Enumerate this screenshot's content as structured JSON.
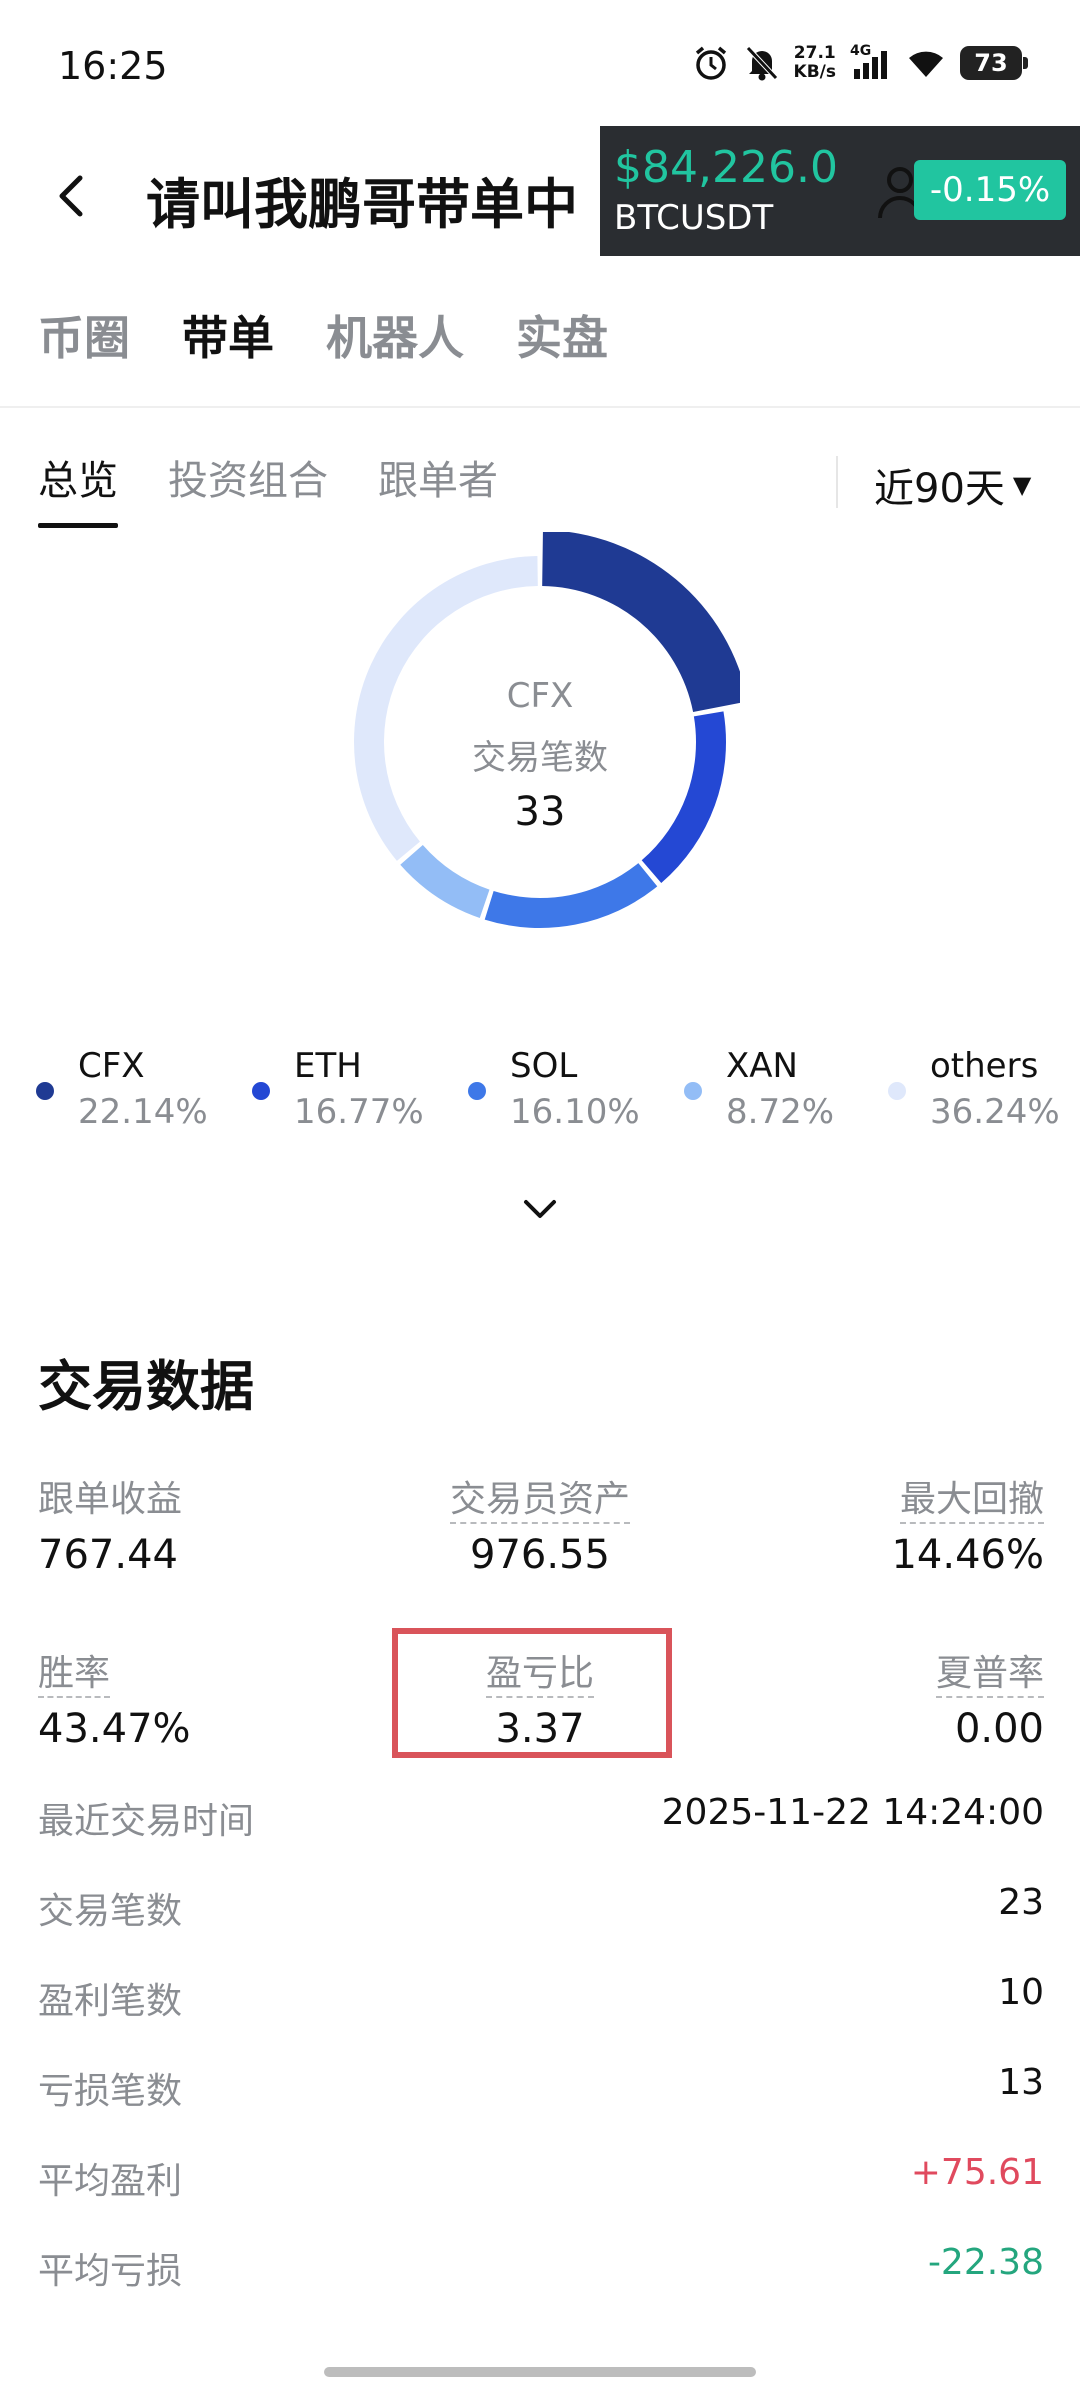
{
  "status_bar": {
    "time": "16:25",
    "net_speed_value": "27.1",
    "net_speed_unit": "KB/s",
    "network": "4G",
    "battery": "73"
  },
  "header": {
    "title": "请叫我鹏哥带单中",
    "back_icon": "chevron-left-icon"
  },
  "ticker": {
    "price": "$84,226.0",
    "symbol": "BTCUSDT",
    "change": "-0.15%"
  },
  "main_tabs": [
    "币圈",
    "带单",
    "机器人",
    "实盘"
  ],
  "main_tab_active": 1,
  "sub_tabs": [
    "总览",
    "投资组合",
    "跟单者"
  ],
  "sub_tab_active": 0,
  "period": "近90天",
  "chart_data": {
    "type": "pie",
    "categories": [
      "CFX",
      "ETH",
      "SOL",
      "XAN",
      "others"
    ],
    "values": [
      22.14,
      16.77,
      16.1,
      8.72,
      36.24
    ],
    "labels": [
      "22.14%",
      "16.77%",
      "16.10%",
      "8.72%",
      "36.24%"
    ],
    "colors": [
      "#1f3a93",
      "#2448d4",
      "#3e78e8",
      "#93bdf6",
      "#dfe8fb"
    ],
    "center": {
      "symbol": "CFX",
      "label": "交易笔数",
      "value": "33"
    }
  },
  "trading": {
    "title": "交易数据",
    "stats": [
      {
        "label": "跟单收益",
        "value": "767.44"
      },
      {
        "label": "交易员资产",
        "value": "976.55"
      },
      {
        "label": "最大回撤",
        "value": "14.46%"
      },
      {
        "label": "胜率",
        "value": "43.47%"
      },
      {
        "label": "盈亏比",
        "value": "3.37"
      },
      {
        "label": "夏普率",
        "value": "0.00"
      }
    ],
    "rows": [
      {
        "label": "最近交易时间",
        "value": "2025-11-22 14:24:00"
      },
      {
        "label": "交易笔数",
        "value": "23"
      },
      {
        "label": "盈利笔数",
        "value": "10"
      },
      {
        "label": "亏损笔数",
        "value": "13"
      },
      {
        "label": "平均盈利",
        "value": "+75.61"
      },
      {
        "label": "平均亏损",
        "value": "-22.38"
      }
    ]
  }
}
